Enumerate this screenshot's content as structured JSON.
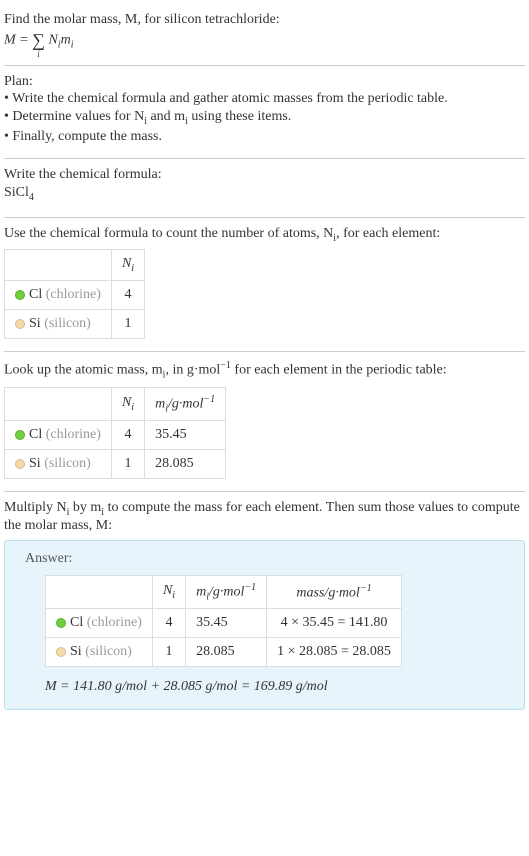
{
  "intro": {
    "line1": "Find the molar mass, M, for silicon tetrachloride:",
    "formula_lhs": "M = ",
    "sum_sub": "i",
    "formula_rhs": " N",
    "formula_sub1": "i",
    "formula_rhs2": "m",
    "formula_sub2": "i"
  },
  "plan": {
    "heading": "Plan:",
    "bullet1": "• Write the chemical formula and gather atomic masses from the periodic table.",
    "bullet2_a": "• Determine values for N",
    "bullet2_sub1": "i",
    "bullet2_b": " and m",
    "bullet2_sub2": "i",
    "bullet2_c": " using these items.",
    "bullet3": "• Finally, compute the mass."
  },
  "chem": {
    "heading": "Write the chemical formula:",
    "formula_base": "SiCl",
    "formula_sub": "4"
  },
  "count": {
    "heading_a": "Use the chemical formula to count the number of atoms, N",
    "heading_sub": "i",
    "heading_b": ", for each element:",
    "table": {
      "header_ni": "N",
      "header_ni_sub": "i",
      "rows": [
        {
          "dot": "cl",
          "symbol": "Cl",
          "name": "(chlorine)",
          "ni": "4"
        },
        {
          "dot": "si",
          "symbol": "Si",
          "name": "(silicon)",
          "ni": "1"
        }
      ]
    }
  },
  "lookup": {
    "heading_a": "Look up the atomic mass, m",
    "heading_sub": "i",
    "heading_b": ", in g·mol",
    "heading_sup": "−1",
    "heading_c": " for each element in the periodic table:",
    "table": {
      "header_ni": "N",
      "header_ni_sub": "i",
      "header_mi": "m",
      "header_mi_sub": "i",
      "header_mi_unit": "/g·mol",
      "header_mi_sup": "−1",
      "rows": [
        {
          "dot": "cl",
          "symbol": "Cl",
          "name": "(chlorine)",
          "ni": "4",
          "mi": "35.45"
        },
        {
          "dot": "si",
          "symbol": "Si",
          "name": "(silicon)",
          "ni": "1",
          "mi": "28.085"
        }
      ]
    }
  },
  "multiply": {
    "heading_a": "Multiply N",
    "heading_sub1": "i",
    "heading_b": " by m",
    "heading_sub2": "i",
    "heading_c": " to compute the mass for each element. Then sum those values to compute the molar mass, M:"
  },
  "answer": {
    "label": "Answer:",
    "table": {
      "header_ni": "N",
      "header_ni_sub": "i",
      "header_mi": "m",
      "header_mi_sub": "i",
      "header_mi_unit": "/g·mol",
      "header_mi_sup": "−1",
      "header_mass": "mass/g·mol",
      "header_mass_sup": "−1",
      "rows": [
        {
          "dot": "cl",
          "symbol": "Cl",
          "name": "(chlorine)",
          "ni": "4",
          "mi": "35.45",
          "mass": "4 × 35.45 = 141.80"
        },
        {
          "dot": "si",
          "symbol": "Si",
          "name": "(silicon)",
          "ni": "1",
          "mi": "28.085",
          "mass": "1 × 28.085 = 28.085"
        }
      ]
    },
    "result": "M = 141.80 g/mol + 28.085 g/mol = 169.89 g/mol"
  },
  "chart_data": {
    "type": "table",
    "title": "Molar mass computation for SiCl4",
    "elements": [
      {
        "element": "Cl",
        "name": "chlorine",
        "N_i": 4,
        "m_i_g_per_mol": 35.45,
        "mass_g_per_mol": 141.8
      },
      {
        "element": "Si",
        "name": "silicon",
        "N_i": 1,
        "m_i_g_per_mol": 28.085,
        "mass_g_per_mol": 28.085
      }
    ],
    "molar_mass_g_per_mol": 169.89
  }
}
